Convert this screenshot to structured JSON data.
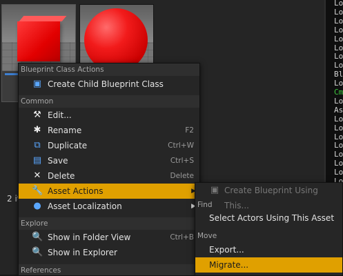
{
  "content_browser": {
    "assets": [
      {
        "name": "red-cube-asset",
        "selected": true
      },
      {
        "name": "red-sphere-asset",
        "selected": false
      }
    ],
    "item_count_text": "2 it"
  },
  "output_log": {
    "lines": [
      "Lo",
      "Lo",
      "Lo",
      "Lo",
      "Lo",
      "Lo",
      "Lo",
      "Lo",
      "Bl",
      "Lo",
      "Cm",
      "Lo",
      "As",
      "Lo",
      "Lo",
      "Lo",
      "Lo",
      "Lo",
      "Lo",
      "Lo",
      "Lo"
    ],
    "command_line_color": "#3fc83f"
  },
  "context_menu": {
    "sections": {
      "blueprint": "Blueprint Class Actions",
      "common": "Common",
      "explore": "Explore",
      "references": "References"
    },
    "items": {
      "create_child": {
        "label": "Create Child Blueprint Class",
        "icon": "blueprint-icon"
      },
      "edit": {
        "label": "Edit...",
        "icon": "hammer-icon"
      },
      "rename": {
        "label": "Rename",
        "shortcut": "F2",
        "icon": "rename-icon"
      },
      "duplicate": {
        "label": "Duplicate",
        "shortcut": "Ctrl+W",
        "icon": "duplicate-icon"
      },
      "save": {
        "label": "Save",
        "shortcut": "Ctrl+S",
        "icon": "save-icon"
      },
      "delete": {
        "label": "Delete",
        "shortcut": "Delete",
        "icon": "delete-icon"
      },
      "asset_actions": {
        "label": "Asset Actions",
        "icon": "wrench-icon",
        "highlighted": true
      },
      "asset_localization": {
        "label": "Asset Localization",
        "icon": "globe-icon"
      },
      "show_folder": {
        "label": "Show in Folder View",
        "shortcut": "Ctrl+B",
        "icon": "magnifier-icon"
      },
      "show_explorer": {
        "label": "Show in Explorer",
        "icon": "magnifier-icon"
      }
    }
  },
  "submenu": {
    "create_bp": "Create Blueprint Using This...",
    "find_heading": "Find",
    "select_actors": "Select Actors Using This Asset",
    "move_heading": "Move",
    "export": "Export...",
    "migrate": "Migrate..."
  },
  "colors": {
    "highlight": "#e0a000",
    "menu_bg": "#262626",
    "selection_bar": "#3d7fd1"
  }
}
